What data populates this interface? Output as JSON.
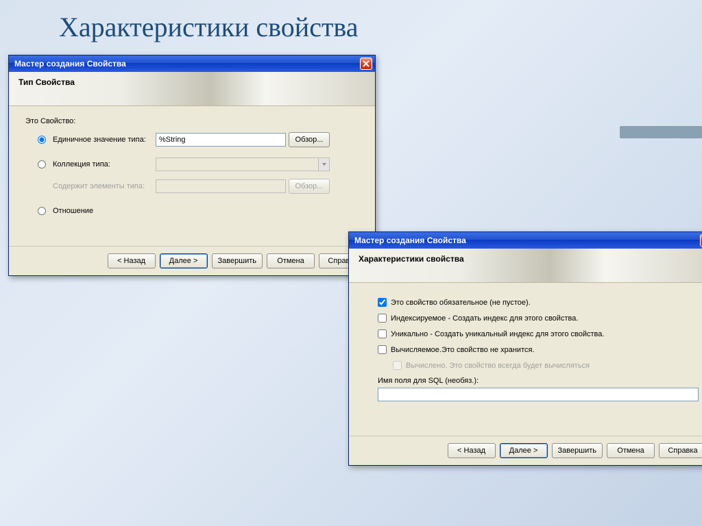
{
  "slide": {
    "title": "Характеристики свойства"
  },
  "win1": {
    "title": "Мастер создания Свойства",
    "header": "Тип Свойства",
    "section": "Это Свойство:",
    "radios": {
      "single": "Единичное значение типа:",
      "collection": "Коллекция типа:",
      "containsLabel": "Содержит элементы типа:",
      "relation": "Отношение"
    },
    "typeValue": "%String",
    "browse": "Обзор...",
    "browseDisabled": "Обзор...",
    "buttons": {
      "back": "< Назад",
      "next": "Далее >",
      "finish": "Завершить",
      "cancel": "Отмена",
      "help": "Справка"
    }
  },
  "win2": {
    "title": "Мастер создания Свойства",
    "header": "Характеристики свойства",
    "checks": {
      "required": "Это свойство обязательное (не пустое).",
      "indexed": "Индексируемое - Создать индекс для этого свойства.",
      "unique": "Уникально - Создать уникальный индекс для этого свойства.",
      "computed": "Вычисляемое.Это свойство не хранится.",
      "computedAlways": "Вычислено. Это свойство всегда будет вычисляться"
    },
    "sqlLabel": "Имя поля для SQL (необяз.):",
    "buttons": {
      "back": "< Назад",
      "next": "Далее >",
      "finish": "Завершить",
      "cancel": "Отмена",
      "help": "Справка"
    }
  }
}
